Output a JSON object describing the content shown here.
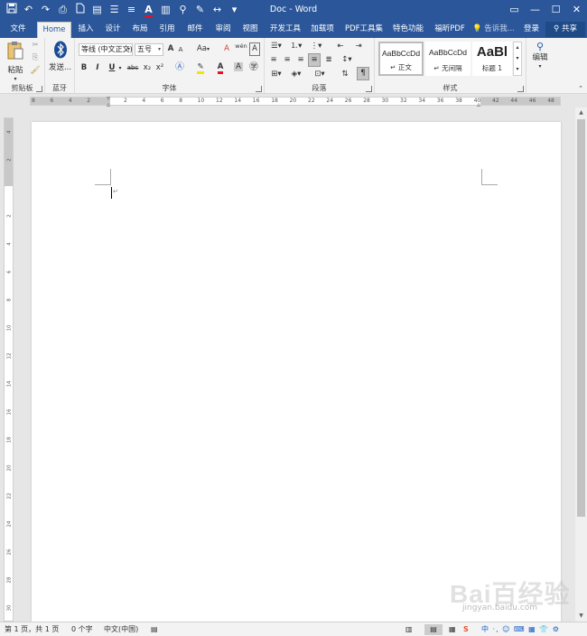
{
  "window": {
    "title": "Doc - Word",
    "controls": {
      "ribbon_display": "▭",
      "minimize": "—",
      "maximize": "☐",
      "close": "✕"
    }
  },
  "qat": [
    "save-icon",
    "undo-icon",
    "redo-icon",
    "print-preview-icon",
    "new-doc-icon",
    "paste-icon",
    "view-icon",
    "align-icon",
    "font-color-icon",
    "read-mode-icon",
    "find-icon",
    "draw-icon",
    "spacing-icon",
    "customize-icon"
  ],
  "tabs": {
    "file": "文件",
    "home": "Home",
    "insert": "插入",
    "design": "设计",
    "layout": "布局",
    "references": "引用",
    "mailings": "邮件",
    "review": "审阅",
    "view": "视图",
    "developer": "开发工具",
    "addins": "加载项",
    "pdf_tools": "PDF工具集",
    "features": "特色功能",
    "foxit_pdf": "福昕PDF",
    "tell_me": "告诉我...",
    "sign_in": "登录",
    "share": "共享"
  },
  "ribbon": {
    "clipboard": {
      "label": "剪贴板",
      "paste": "粘贴"
    },
    "bluetooth": {
      "label": "蓝牙",
      "send": "发送..."
    },
    "font": {
      "label": "字体",
      "font_name": "等线 (中文正文)",
      "font_size": "五号",
      "bold": "B",
      "italic": "I",
      "underline": "U",
      "strike": "abc",
      "subscript": "x₂",
      "superscript": "x²",
      "grow": "A",
      "shrink": "A",
      "case": "Aa",
      "clear": "A",
      "phonetic": "wén",
      "border_char": "A"
    },
    "paragraph": {
      "label": "段落"
    },
    "styles": {
      "label": "样式",
      "items": [
        {
          "sample": "AaBbCcDd",
          "name": "↵ 正文"
        },
        {
          "sample": "AaBbCcDd",
          "name": "↵ 无间隔"
        },
        {
          "sample": "AaBl",
          "name": "标题 1"
        }
      ]
    },
    "editing": {
      "label": "编辑"
    }
  },
  "ruler": {
    "h_ticks": [
      "8",
      "6",
      "4",
      "2",
      "",
      "2",
      "4",
      "6",
      "8",
      "10",
      "12",
      "14",
      "16",
      "18",
      "20",
      "22",
      "24",
      "26",
      "28",
      "30",
      "32",
      "34",
      "36",
      "38",
      "40",
      "42",
      "44",
      "46",
      "48"
    ],
    "v_ticks": [
      "4",
      "2",
      "",
      "2",
      "4",
      "6",
      "8",
      "10",
      "12",
      "14",
      "16",
      "18",
      "20",
      "22",
      "24",
      "26",
      "28",
      "30"
    ]
  },
  "statusbar": {
    "page": "第 1 页，共 1 页",
    "words": "0 个字",
    "language": "中文(中国)",
    "zoom": "−  +"
  },
  "ime_toolbar": "中 ·, ☺ ⌨ ▦ 👕 ⚙",
  "watermark": {
    "text": "Bai百经验",
    "sub": "jingyan.baidu.com"
  }
}
